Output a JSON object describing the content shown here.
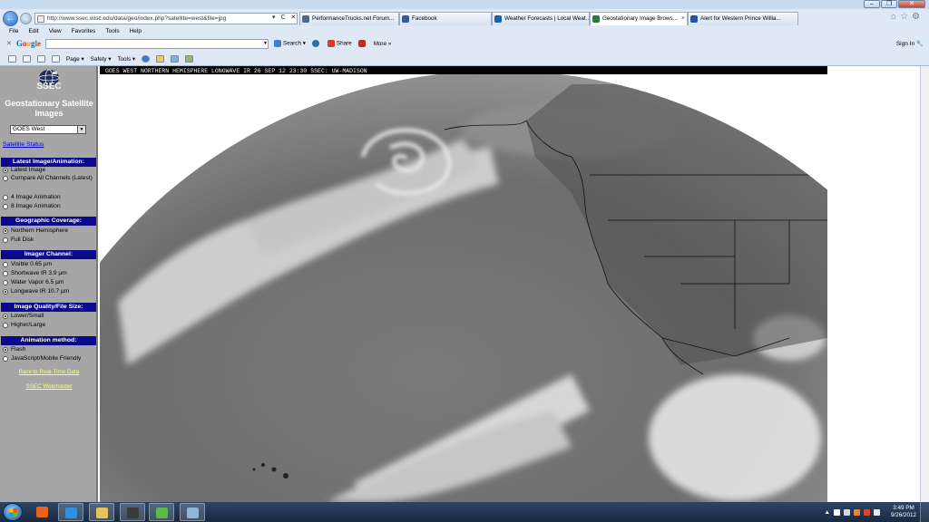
{
  "browser": {
    "address": "http://www.ssec.wisc.edu/data/geo/index.php?satellite=west&file=jpg",
    "address_controls": "▾ C ✕",
    "tabs": [
      {
        "label": "PerformanceTrucks.net Forum...",
        "icon_color": "#4a6a8a",
        "active": false
      },
      {
        "label": "Facebook",
        "icon_color": "#3b5998",
        "active": false
      },
      {
        "label": "Weather Forecasts | Local Weat...",
        "icon_color": "#1c5fa8",
        "active": false
      },
      {
        "label": "Geostationary Image Brows...",
        "icon_color": "#2a7a3a",
        "active": true
      },
      {
        "label": "Alert for Western Prince Willia...",
        "icon_color": "#2255aa",
        "active": false
      }
    ],
    "menu": [
      "File",
      "Edit",
      "View",
      "Favorites",
      "Tools",
      "Help"
    ],
    "google": {
      "close": "✕",
      "logo": "Google",
      "search_label": "Search",
      "share_label": "Share",
      "more_label": "More »",
      "signin_label": "Sign In"
    },
    "command": {
      "page_label": "Page ▾",
      "safety_label": "Safety ▾",
      "tools_label": "Tools ▾"
    }
  },
  "sidebar": {
    "logo_text": "SSEC",
    "title": "Geostationary Satellite Images",
    "satellite_selected": "GOES West",
    "status_link": "Satellite Status",
    "sections": {
      "latest": {
        "header": "Latest Image/Animation:",
        "options": [
          "Latest Image",
          "Compare All Channels (Latest)",
          "4 Image Animation",
          "8 Image Animation"
        ],
        "selected": 0
      },
      "coverage": {
        "header": "Geographic Coverage:",
        "options": [
          "Northern Hemisphere",
          "Full Disk"
        ],
        "selected": 0
      },
      "channel": {
        "header": "Imager Channel:",
        "options": [
          "Visible 0.65 µm",
          "Shortwave IR 3.9 µm",
          "Water Vapor 6.5 µm",
          "Longwave IR 10.7 µm"
        ],
        "selected": 3
      },
      "quality": {
        "header": "Image Quality/File Size:",
        "options": [
          "Lower/Small",
          "Higher/Large"
        ],
        "selected": 0
      },
      "animation": {
        "header": "Animation method:",
        "options": [
          "Flash",
          "JavaScript/Mobile Friendly"
        ],
        "selected": 0
      }
    },
    "back_link": "Back to Real-Time Data",
    "webmaster_link": "SSEC Webmaster"
  },
  "image": {
    "caption": "GOES WEST NORTHERN HEMISPHERE LONGWAVE IR 26 SEP 12 23:30 SSEC: UW-MADISON"
  },
  "taskbar": {
    "apps": [
      {
        "name": "media-player-icon",
        "color": "#e8631c"
      },
      {
        "name": "internet-explorer-icon",
        "color": "#2f8fe0"
      },
      {
        "name": "file-explorer-icon",
        "color": "#e5c25a"
      },
      {
        "name": "m-plus-app-icon",
        "color": "#3a3a3a"
      },
      {
        "name": "green-app-icon",
        "color": "#59b94a"
      },
      {
        "name": "window-app-icon",
        "color": "#8fb4d6"
      }
    ],
    "time": "3:49 PM",
    "date": "9/26/2012"
  }
}
